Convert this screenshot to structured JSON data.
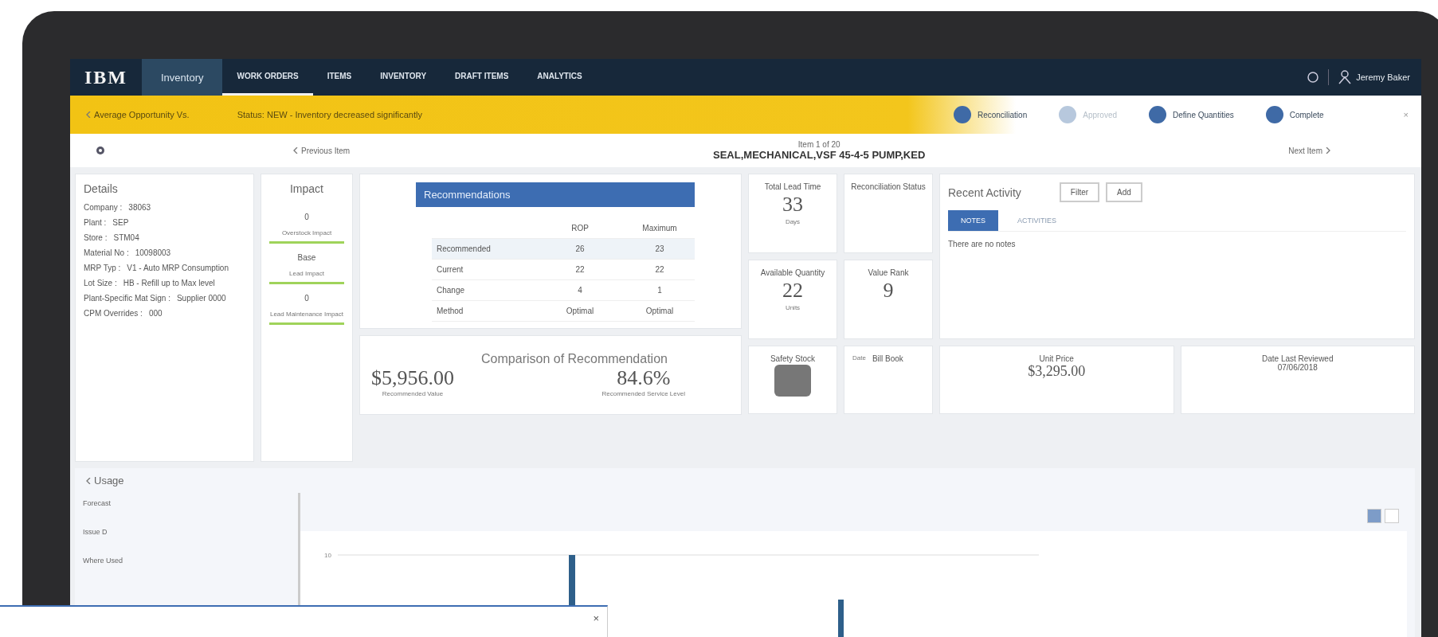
{
  "navbar": {
    "logo": "IBM",
    "app_menu": "Inventory",
    "tabs": [
      {
        "label": "WORK ORDERS",
        "selected": true
      },
      {
        "label": "ITEMS",
        "selected": false
      },
      {
        "label": "INVENTORY",
        "selected": false
      },
      {
        "label": "DRAFT ITEMS",
        "selected": false
      },
      {
        "label": "ANALYTICS",
        "selected": false
      }
    ],
    "user": "Jeremy Baker"
  },
  "alert_bar": {
    "back": "Average Opportunity Vs.",
    "status": "Status: NEW - Inventory decreased significantly",
    "steps": [
      {
        "label": "Reconciliation",
        "done": true
      },
      {
        "label": "Approved",
        "done": false
      },
      {
        "label": "Define Quantities",
        "done": true
      },
      {
        "label": "Complete",
        "done": true
      }
    ]
  },
  "item_header": {
    "previous": "Previous Item",
    "counter": "Item 1 of 20",
    "title": "SEAL,MECHANICAL,VSF 45-4-5 PUMP,KED",
    "next": "Next Item"
  },
  "details": {
    "title": "Details",
    "fields": [
      {
        "label": "Company :",
        "value": "38063"
      },
      {
        "label": "Plant :",
        "value": "SEP"
      },
      {
        "label": "Store :",
        "value": "STM04"
      },
      {
        "label": "Material No :",
        "value": "10098003"
      },
      {
        "label": "MRP Typ :",
        "value": "V1 - Auto MRP Consumption"
      },
      {
        "label": "Lot Size :",
        "value": "HB - Refill up to Max level"
      },
      {
        "label": "Plant-Specific Mat Sign :",
        "value": "Supplier 0000"
      },
      {
        "label": "CPM Overrides :",
        "value": "000"
      }
    ]
  },
  "impact": {
    "title": "Impact",
    "items": [
      {
        "value": "0",
        "label": "Overstock Impact"
      },
      {
        "value": "Base",
        "label": "Lead Impact"
      },
      {
        "value": "0",
        "label": "Lead Maintenance Impact"
      }
    ]
  },
  "recommendations": {
    "title": "Recommendations",
    "columns": [
      "ROP",
      "Maximum"
    ],
    "rows": [
      {
        "label": "Recommended",
        "values": [
          "26",
          "23"
        ],
        "selected": true
      },
      {
        "label": "Current",
        "values": [
          "22",
          "22"
        ],
        "selected": false
      },
      {
        "label": "Change",
        "values": [
          "4",
          "1"
        ],
        "selected": false
      },
      {
        "label": "Method",
        "values": [
          "Optimal",
          "Optimal"
        ],
        "selected": false
      }
    ]
  },
  "comparison": {
    "title": "Comparison of Recommendation",
    "metrics": [
      {
        "value": "$5,956.00",
        "label": "Recommended Value"
      },
      {
        "value": "84.6%",
        "label": "Recommended Service Level"
      }
    ]
  },
  "stats": [
    {
      "label": "Total Lead Time",
      "value": "33",
      "unit": "Days"
    },
    {
      "label": "Reconciliation Status"
    },
    {
      "label": "Available Quantity",
      "value": "22",
      "unit": "Units"
    },
    {
      "label": "Value Rank",
      "value": "9"
    }
  ],
  "bottom_cards": {
    "safety": "Safety Stock",
    "bill": "Bill Book",
    "bill_sub": "Date",
    "unit_price_label": "Unit Price",
    "unit_price": "$3,295.00",
    "reviewed_label": "Date Last Reviewed",
    "reviewed": "07/06/2018"
  },
  "activity": {
    "title": "Recent Activity",
    "buttons": [
      "Filter",
      "Add"
    ],
    "tabs": [
      {
        "label": "NOTES",
        "selected": true
      },
      {
        "label": "ACTIVITIES",
        "selected": false
      }
    ],
    "empty": "There are no notes"
  },
  "usage": {
    "title": "Usage",
    "side_items": [
      "Forecast",
      "Issue D",
      "Where Used"
    ],
    "y_tick": "10",
    "views": [
      {
        "selected": true
      },
      {
        "selected": false
      }
    ]
  },
  "popup": {
    "close": "×"
  }
}
